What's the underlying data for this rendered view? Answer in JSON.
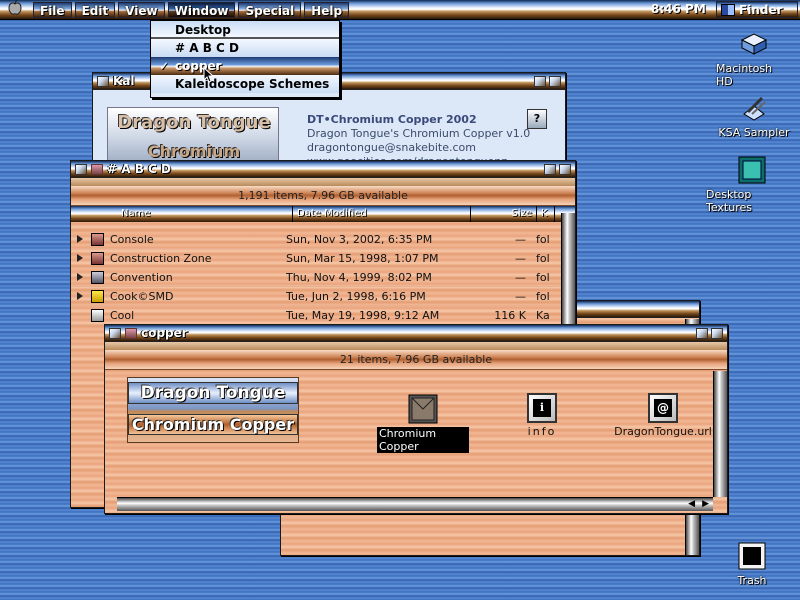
{
  "menubar": {
    "apple_glyph": "",
    "items": [
      "File",
      "Edit",
      "View",
      "Window",
      "Special",
      "Help"
    ],
    "clock": "8:46 PM",
    "app": "Finder"
  },
  "window_menu": {
    "items": [
      "Desktop",
      "# A B C D",
      "copper",
      "Kaleidoscope Schemes"
    ],
    "checked": "✓"
  },
  "desktop": {
    "icons": [
      "Macintosh HD",
      "KSA Sampler",
      "Desktop Textures",
      "Trash"
    ]
  },
  "kaleido_window": {
    "title_partial": "Kal",
    "logo_line1": "Dragon Tongue",
    "logo_line2": "Chromium Copper",
    "heading": "DT•Chromium Copper 2002",
    "line1": "Dragon Tongue's Chromium Copper v1.0",
    "line2": "dragontongue@snakebite.com",
    "line3": "www.geocities.com/dragontonguenz",
    "help_glyph": "?"
  },
  "abcd_window": {
    "title": "# A B C D",
    "info": "1,191 items, 7.96 GB available",
    "columns": [
      "Name",
      "Date Modified",
      "Size",
      "K"
    ],
    "rows": [
      {
        "name": "Console",
        "date": "Sun, Nov 3, 2002, 6:35 PM",
        "size": "—",
        "kind": "fol"
      },
      {
        "name": "Construction Zone",
        "date": "Sun, Mar 15, 1998, 1:07 PM",
        "size": "—",
        "kind": "fol"
      },
      {
        "name": "Convention",
        "date": "Thu, Nov 4, 1999, 8:02 PM",
        "size": "—",
        "kind": "fol"
      },
      {
        "name": "Cook©SMD",
        "date": "Tue, Jun 2, 1998, 6:16 PM",
        "size": "—",
        "kind": "fol"
      },
      {
        "name": "Cool",
        "date": "Tue, May 19, 1998, 9:12 AM",
        "size": "116 K",
        "kind": "Ka"
      }
    ]
  },
  "copper_window": {
    "title": "copper",
    "info": "21 items, 7.96 GB available",
    "logo_line1": "Dragon Tongue",
    "logo_line2": "Chromium Copper",
    "icons": [
      "Chromium Copper",
      "info",
      "DragonTongue.url"
    ],
    "info_glyph": "i",
    "url_glyph": "@"
  },
  "colors": {
    "accent_blue": "#3a6fbf",
    "copper": "#e8a47e"
  }
}
